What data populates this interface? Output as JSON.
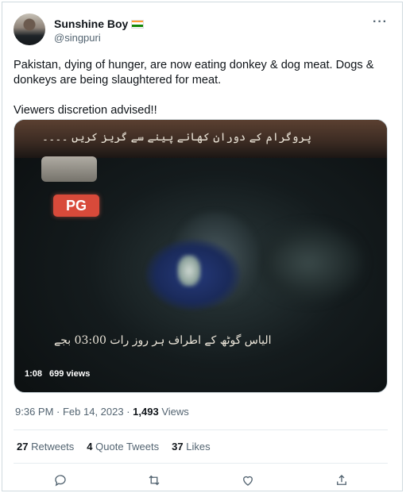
{
  "author": {
    "display_name": "Sunshine Boy",
    "handle": "@singpuri",
    "flag_colors": [
      "#ff9933",
      "#ffffff",
      "#138808"
    ]
  },
  "more_icon": "more-horizontal-icon",
  "tweet": {
    "text_line1": "Pakistan, dying of hunger, are now eating donkey & dog meat. Dogs & donkeys are being slaughtered for meat.",
    "text_line2": "Viewers discretion advised!!"
  },
  "video": {
    "overlay_top_text": "پروگرام کے دوران کھانے پینے سے گریز کریں ۔۔۔۔",
    "rating_badge": "PG",
    "overlay_bottom_text": "الیاس گوٹھ کے اطراف ہر روز رات 03:00 بجے",
    "duration": "1:08",
    "views": "699 views"
  },
  "meta": {
    "time": "9:36 PM",
    "date": "Feb 14, 2023",
    "view_count": "1,493",
    "view_label": "Views"
  },
  "stats": {
    "retweets_count": "27",
    "retweets_label": "Retweets",
    "quotes_count": "4",
    "quotes_label": "Quote Tweets",
    "likes_count": "37",
    "likes_label": "Likes"
  },
  "actions": [
    "reply-icon",
    "retweet-icon",
    "like-icon",
    "share-icon"
  ]
}
